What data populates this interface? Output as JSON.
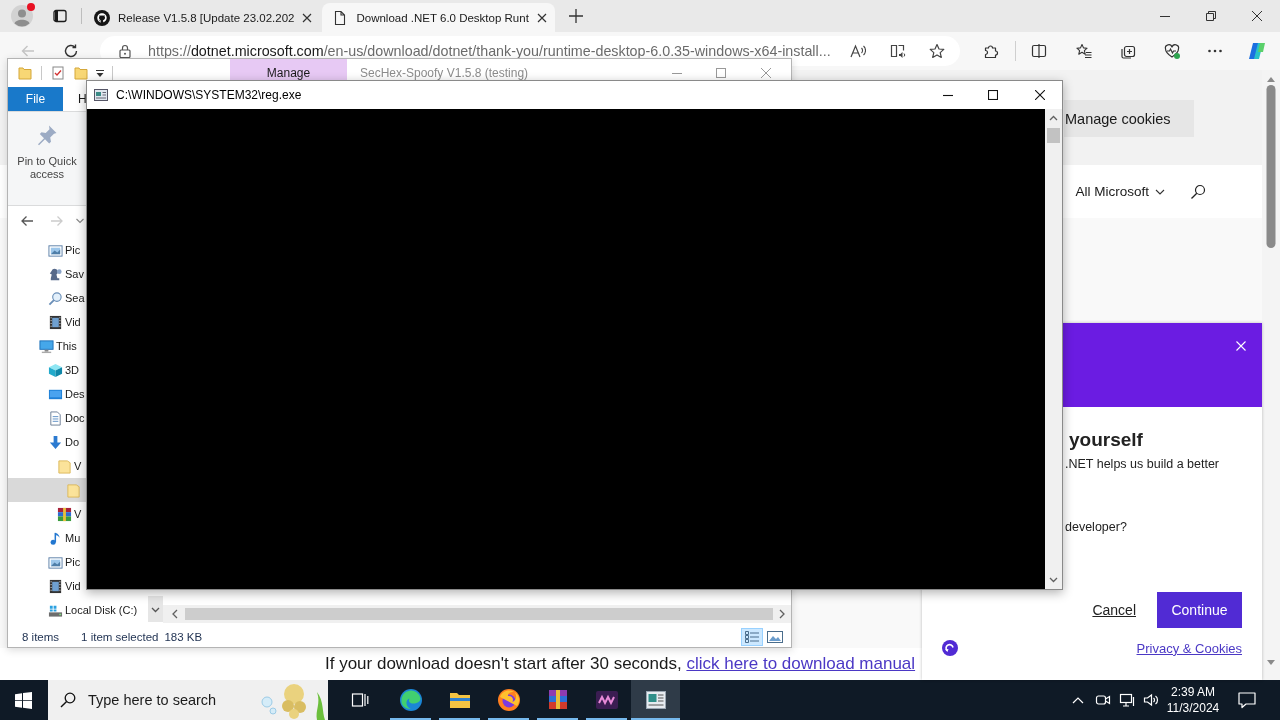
{
  "browser": {
    "profile": {
      "notification": true
    },
    "tabs": [
      {
        "kind": "github",
        "title": "Release V1.5.8 [Update 23.02.202",
        "selected": false
      },
      {
        "kind": "page",
        "title": "Download .NET 6.0 Desktop Runt",
        "selected": true
      }
    ],
    "back_disabled": true,
    "address": {
      "scheme": "https://",
      "domain": "dotnet.microsoft.com",
      "path": "/en-us/download/dotnet/thank-you/runtime-desktop-6.0.35-windows-x64-install..."
    },
    "page": {
      "cookie_button": "Manage cookies",
      "nav_menu": "All Microsoft",
      "dialog": {
        "heading": "yourself",
        "lines": [
          ".NET helps us build a better",
          "developer?"
        ],
        "cancel": "Cancel",
        "continue": "Continue",
        "privacy_link": "Privacy & Cookies"
      },
      "download_note": {
        "text": "If your download doesn't start after 30 seconds,",
        "link": "click here to download manual"
      }
    }
  },
  "explorer": {
    "contextual_tab": "Manage",
    "title": "SecHex-Spoofy V1.5.8 (testing)",
    "ribbon_tabs": [
      {
        "kind": "file",
        "label": "File"
      },
      {
        "kind": "tab",
        "label": "H"
      }
    ],
    "ribbon_command": "Pin to Quick access",
    "forward_disabled": true,
    "tree": [
      {
        "children": [
          {
            "kind": "pictures",
            "label": "Pic",
            "selected": false
          },
          {
            "kind": "games",
            "label": "Sav",
            "selected": false
          },
          {
            "kind": "searches",
            "label": "Sea",
            "selected": false
          },
          {
            "kind": "videos",
            "label": "Vid",
            "selected": false
          }
        ]
      },
      {
        "kind": "pc",
        "label": "This",
        "selected": false,
        "children": [
          {
            "kind": "objects",
            "label": "3D",
            "selected": false
          },
          {
            "kind": "desktop",
            "label": "Des",
            "selected": false
          },
          {
            "kind": "documents",
            "label": "Doc",
            "selected": false
          },
          {
            "kind": "downloads",
            "label": "Do",
            "selected": false,
            "children": [
              {
                "kind": "folder",
                "label": "V",
                "selected": false,
                "children": [
                  {
                    "kind": "folder",
                    "selected": true
                  }
                ]
              },
              {
                "kind": "archive",
                "label": "V",
                "selected": false
              }
            ]
          },
          {
            "kind": "music",
            "label": "Mu",
            "selected": false
          },
          {
            "kind": "pictures",
            "label": "Pic",
            "selected": false
          },
          {
            "kind": "videos",
            "label": "Vid",
            "selected": false
          },
          {
            "kind": "disk",
            "label": "Local Disk (C:)",
            "selected": false
          }
        ]
      }
    ],
    "status": {
      "count": "8 items",
      "selection": "1 item selected",
      "size": "183 KB"
    },
    "views": [
      {
        "kind": "details",
        "selected": true
      },
      {
        "kind": "tiles",
        "selected": false
      }
    ]
  },
  "console": {
    "title": "C:\\WINDOWS\\SYSTEM32\\reg.exe"
  },
  "taskbar": {
    "search": {
      "placeholder": "Type here to search"
    },
    "apps": [
      {
        "kind": "edge",
        "running": true,
        "selected": false
      },
      {
        "kind": "explorer",
        "running": true,
        "selected": false
      },
      {
        "kind": "firefox",
        "running": true,
        "selected": false
      },
      {
        "kind": "winrar",
        "running": true,
        "selected": false
      },
      {
        "kind": "sechex",
        "running": true,
        "selected": false
      },
      {
        "kind": "console",
        "running": true,
        "selected": true
      }
    ],
    "time": "2:39 AM",
    "date": "11/3/2024"
  }
}
